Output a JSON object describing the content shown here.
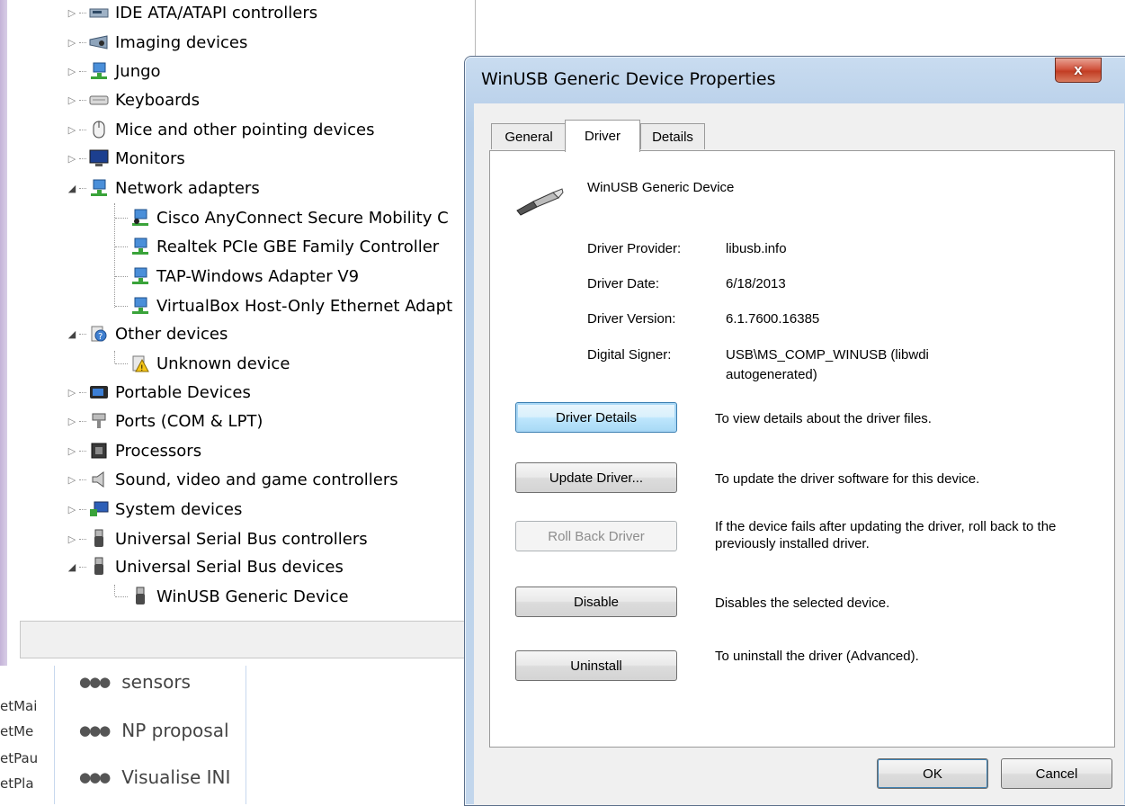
{
  "device_manager": {
    "tree": [
      {
        "label": "IDE ATA/ATAPI controllers",
        "state": "collapsed",
        "icon": "ide-controller-icon",
        "level": 0
      },
      {
        "label": "Imaging devices",
        "state": "collapsed",
        "icon": "imaging-device-icon",
        "level": 0
      },
      {
        "label": "Jungo",
        "state": "collapsed",
        "icon": "network-icon",
        "level": 0
      },
      {
        "label": "Keyboards",
        "state": "collapsed",
        "icon": "keyboard-icon",
        "level": 0
      },
      {
        "label": "Mice and other pointing devices",
        "state": "collapsed",
        "icon": "mouse-icon",
        "level": 0
      },
      {
        "label": "Monitors",
        "state": "collapsed",
        "icon": "monitor-icon",
        "level": 0
      },
      {
        "label": "Network adapters",
        "state": "expanded",
        "icon": "network-icon",
        "level": 0
      },
      {
        "label": "Cisco AnyConnect Secure Mobility C",
        "icon": "network-adapter-icon",
        "level": 1
      },
      {
        "label": "Realtek PCIe GBE Family Controller",
        "icon": "network-adapter-icon",
        "level": 1
      },
      {
        "label": "TAP-Windows Adapter V9",
        "icon": "network-adapter-icon",
        "level": 1
      },
      {
        "label": "VirtualBox Host-Only Ethernet Adapt",
        "icon": "network-adapter-icon",
        "level": 1
      },
      {
        "label": "Other devices",
        "state": "expanded",
        "icon": "unknown-device-icon",
        "level": 0
      },
      {
        "label": "Unknown device",
        "icon": "warning-device-icon",
        "level": 1
      },
      {
        "label": "Portable Devices",
        "state": "collapsed",
        "icon": "portable-device-icon",
        "level": 0
      },
      {
        "label": "Ports (COM & LPT)",
        "state": "collapsed",
        "icon": "port-icon",
        "level": 0
      },
      {
        "label": "Processors",
        "state": "collapsed",
        "icon": "processor-icon",
        "level": 0
      },
      {
        "label": "Sound, video and game controllers",
        "state": "collapsed",
        "icon": "speaker-icon",
        "level": 0
      },
      {
        "label": "System devices",
        "state": "collapsed",
        "icon": "system-device-icon",
        "level": 0
      },
      {
        "label": "Universal Serial Bus controllers",
        "state": "collapsed",
        "icon": "usb-icon",
        "level": 0
      },
      {
        "label": "Universal Serial Bus devices",
        "state": "expanded",
        "icon": "usb-icon",
        "level": 0
      },
      {
        "label": "WinUSB Generic Device",
        "icon": "usb-icon",
        "level": 1
      }
    ]
  },
  "chat_sidebar": {
    "left_labels": [
      "etMai",
      "etMe",
      "etPau",
      "etPla"
    ],
    "groups": [
      {
        "label": "sensors",
        "icon": "group-icon"
      },
      {
        "label": "NP proposal",
        "icon": "group-icon"
      },
      {
        "label": "Visualise INI",
        "icon": "group-icon"
      }
    ]
  },
  "dialog": {
    "title": "WinUSB Generic Device Properties",
    "close_glyph": "x",
    "tabs": [
      {
        "label": "General",
        "active": false
      },
      {
        "label": "Driver",
        "active": true
      },
      {
        "label": "Details",
        "active": false
      }
    ],
    "device_name": "WinUSB Generic Device",
    "info": [
      {
        "label": "Driver Provider:",
        "value": "libusb.info"
      },
      {
        "label": "Driver Date:",
        "value": "6/18/2013"
      },
      {
        "label": "Driver Version:",
        "value": "6.1.7600.16385"
      },
      {
        "label": "Digital Signer:",
        "value": "USB\\MS_COMP_WINUSB (libwdi autogenerated)"
      }
    ],
    "actions": [
      {
        "label": "Driver Details",
        "description": "To view details about the driver files.",
        "state": "focused"
      },
      {
        "label": "Update Driver...",
        "description": "To update the driver software for this device.",
        "state": "normal"
      },
      {
        "label": "Roll Back Driver",
        "description": "If the device fails after updating the driver, roll back to the previously installed driver.",
        "state": "disabled"
      },
      {
        "label": "Disable",
        "description": "Disables the selected device.",
        "state": "normal"
      },
      {
        "label": "Uninstall",
        "description": "To uninstall the driver (Advanced).",
        "state": "normal"
      }
    ],
    "ok_label": "OK",
    "cancel_label": "Cancel"
  },
  "colors": {
    "title_bar": "#c9dcf0",
    "close_button": "#c23d24",
    "focus_blue": "#3c7fb1"
  }
}
